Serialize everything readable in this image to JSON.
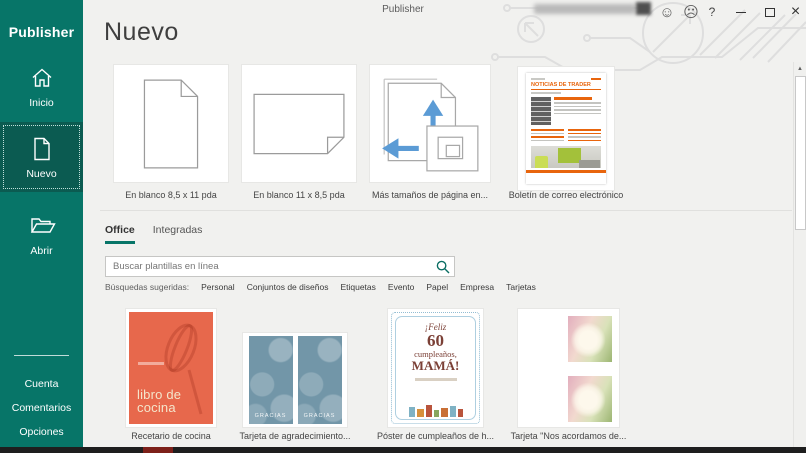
{
  "window": {
    "title": "Publisher",
    "help": "?",
    "close": "×",
    "feedback_happy": "☺",
    "feedback_sad": "☹"
  },
  "sidebar": {
    "app_name": "Publisher",
    "items": [
      {
        "label": "Inicio"
      },
      {
        "label": "Nuevo"
      },
      {
        "label": "Abrir"
      }
    ],
    "footer_items": [
      {
        "label": "Cuenta"
      },
      {
        "label": "Comentarios"
      },
      {
        "label": "Opciones"
      }
    ]
  },
  "main": {
    "heading": "Nuevo",
    "featured_templates": [
      {
        "label": "En blanco 8,5 x 11 pda"
      },
      {
        "label": "En blanco 11 x 8,5 pda"
      },
      {
        "label": "Más tamaños de página en..."
      },
      {
        "label": "Boletín de correo electrónico",
        "preview_title": "NOTICIAS DE TRADER"
      }
    ],
    "tabs": [
      {
        "label": "Office"
      },
      {
        "label": "Integradas"
      }
    ],
    "search": {
      "placeholder": "Buscar plantillas en línea"
    },
    "suggestions": {
      "label": "Búsquedas sugeridas:",
      "links": [
        "Personal",
        "Conjuntos de diseños",
        "Etiquetas",
        "Evento",
        "Papel",
        "Empresa",
        "Tarjetas"
      ]
    },
    "gallery_templates": [
      {
        "label": "Recetario de cocina",
        "preview_lines": [
          "libro de",
          "cocina"
        ]
      },
      {
        "label": "Tarjeta de agradecimiento...",
        "preview_text": "GRACIAS"
      },
      {
        "label": "Póster de cumpleaños de h...",
        "preview_lines": [
          "¡Feliz",
          "60",
          "cumpleaños,",
          "MAMÁ!"
        ]
      },
      {
        "label": "Tarjeta \"Nos acordamos de..."
      }
    ]
  },
  "colors": {
    "accent": "#077568",
    "accent_selected": "#0b5b51",
    "newsletter_orange": "#e8650d",
    "cookbook_orange": "#e7684c",
    "card_blue": "#7296a8",
    "poster_brown": "#7b4036"
  }
}
